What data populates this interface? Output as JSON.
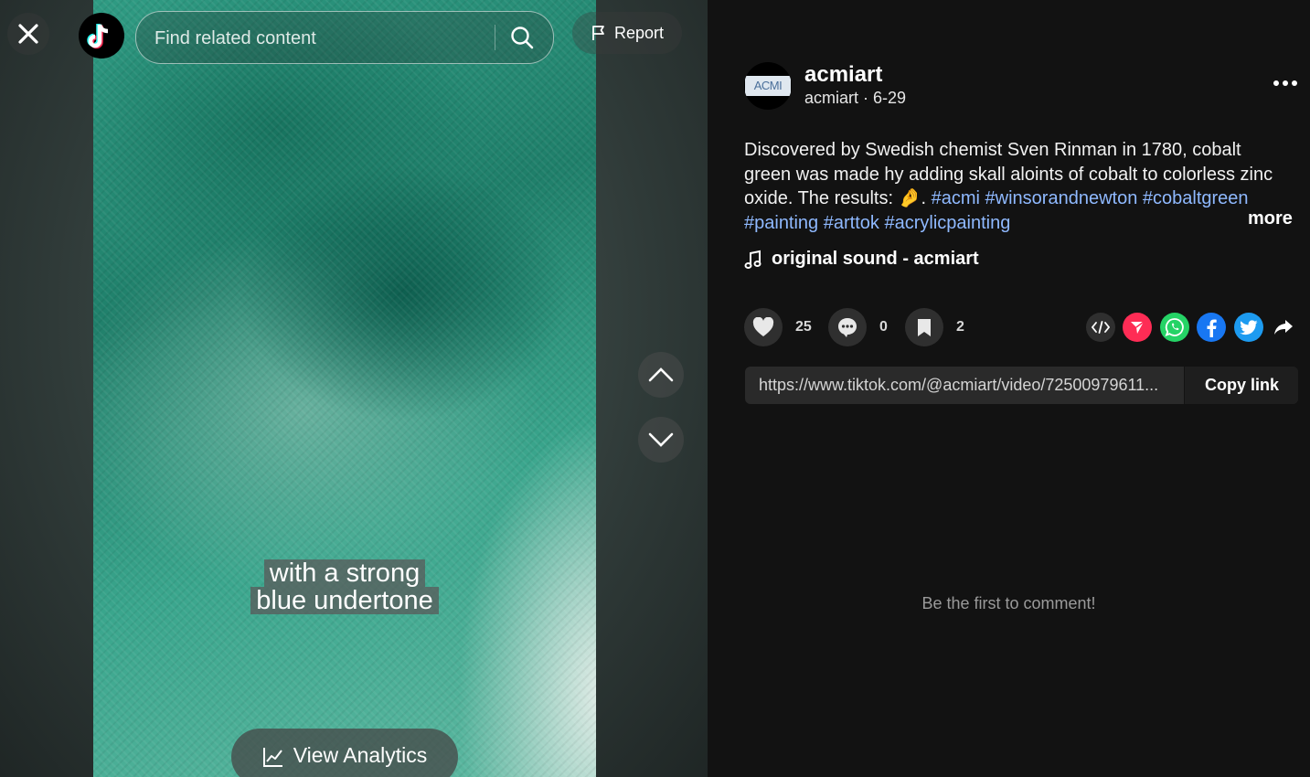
{
  "top_bar": {
    "search_placeholder": "Find related content",
    "report_label": "Report"
  },
  "video": {
    "caption_line1": "with a strong",
    "caption_line2": "blue undertone",
    "analytics_label": "View Analytics"
  },
  "post": {
    "username": "acmiart",
    "handle": "acmiart",
    "separator": " · ",
    "date": "6-29",
    "description_text": "Discovered by Swedish chemist Sven Rinman in 1780, cobalt green was made hy adding skall aloints of cobalt to colorless zinc oxide. The results: 🤌. ",
    "hashtags": [
      "#acmi",
      "#winsorandnewton",
      "#cobaltgreen",
      "#painting",
      "#arttok",
      "#acrylicpainting"
    ],
    "more_label": "more",
    "sound": "original sound - acmiart",
    "avatar_text": "ACMI"
  },
  "actions": {
    "likes": "25",
    "comments": "0",
    "saves": "2"
  },
  "share_icons": [
    "embed-icon",
    "send-to-friends-icon",
    "whatsapp-icon",
    "facebook-icon",
    "twitter-icon",
    "share-arrow-icon"
  ],
  "link": {
    "url": "https://www.tiktok.com/@acmiart/video/72500979611...",
    "copy_label": "Copy link"
  },
  "comments": {
    "empty_text": "Be the first to comment!"
  },
  "colors": {
    "hashtag": "#8fb9ff",
    "send_red": "#fe2c55",
    "whatsapp": "#25d366",
    "facebook": "#1877f2",
    "twitter": "#1d9bf0"
  }
}
